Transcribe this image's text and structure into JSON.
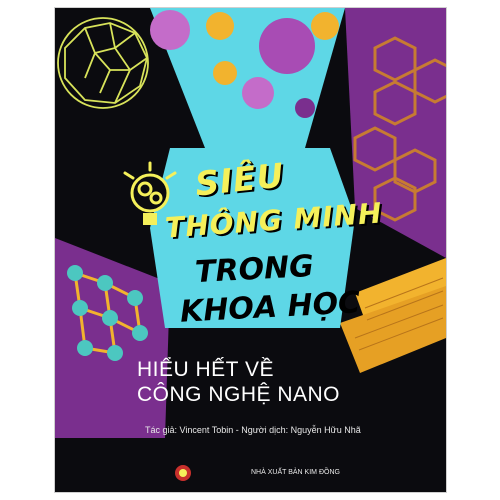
{
  "book": {
    "title_line1": "SIÊU",
    "title_line2": "THÔNG MINH",
    "title_line3": "TRONG",
    "title_line4": "KHOA HỌC",
    "subtitle_line1": "HIỂU HẾT VỀ",
    "subtitle_line2": "CÔNG NGHỆ NANO",
    "credits": "Tác giả: Vincent Tobin - Người dịch: Nguyễn Hữu Nhã",
    "publisher": "NHÀ XUẤT BẢN KIM ĐỒNG"
  },
  "colors": {
    "background": "#0b0b0f",
    "purple": "#7a2f8e",
    "cyan": "#5ed7e6",
    "yellow": "#f5f05a",
    "orange": "#f2b32e"
  }
}
